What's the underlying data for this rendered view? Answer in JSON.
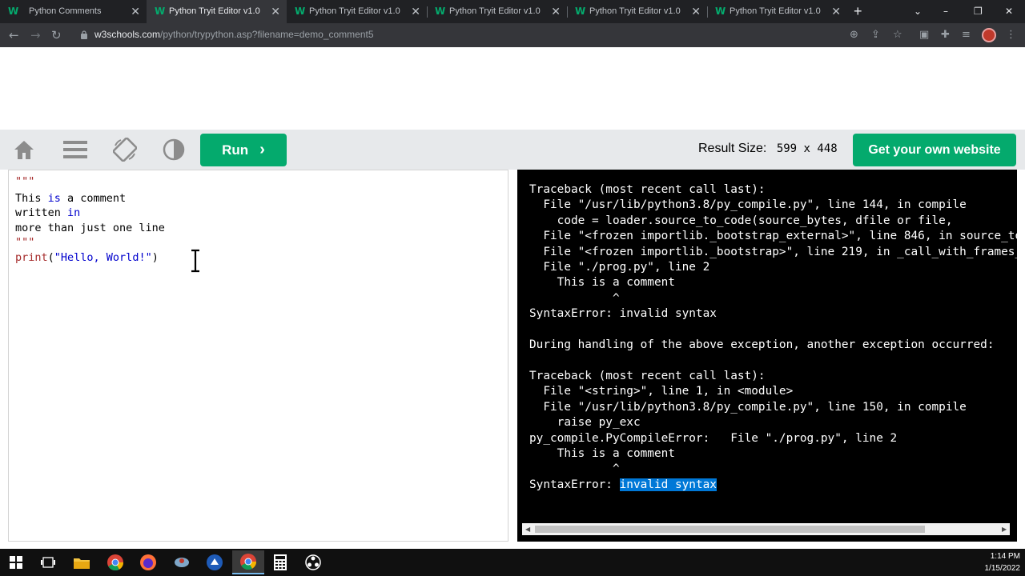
{
  "browser": {
    "tabs": [
      {
        "title": "Python Comments",
        "active": false
      },
      {
        "title": "Python Tryit Editor v1.0",
        "active": true
      },
      {
        "title": "Python Tryit Editor v1.0",
        "active": false
      },
      {
        "title": "Python Tryit Editor v1.0",
        "active": false
      },
      {
        "title": "Python Tryit Editor v1.0",
        "active": false
      },
      {
        "title": "Python Tryit Editor v1.0",
        "active": false
      }
    ],
    "url_host": "w3schools.com",
    "url_path": "/python/trypython.asp?filename=demo_comment5"
  },
  "toolbar": {
    "run_label": "Run",
    "result_size_label": "Result Size:",
    "result_width": "599",
    "result_x": "x",
    "result_height": "448",
    "get_website_label": "Get your own website"
  },
  "editor": {
    "lines": [
      "\"\"\"",
      "This is a comment",
      "written in",
      "more than just one line",
      "\"\"\"",
      "print(\"Hello, World!\")"
    ]
  },
  "output": {
    "lines": [
      "Traceback (most recent call last):",
      "  File \"/usr/lib/python3.8/py_compile.py\", line 144, in compile",
      "    code = loader.source_to_code(source_bytes, dfile or file,",
      "  File \"<frozen importlib._bootstrap_external>\", line 846, in source_to_code",
      "  File \"<frozen importlib._bootstrap>\", line 219, in _call_with_frames_removed",
      "  File \"./prog.py\", line 2",
      "    This is a comment",
      "            ^",
      "SyntaxError: invalid syntax",
      "",
      "During handling of the above exception, another exception occurred:",
      "",
      "Traceback (most recent call last):",
      "  File \"<string>\", line 1, in <module>",
      "  File \"/usr/lib/python3.8/py_compile.py\", line 150, in compile",
      "    raise py_exc",
      "py_compile.PyCompileError:   File \"./prog.py\", line 2",
      "    This is a comment",
      "            ^"
    ],
    "last_prefix": "SyntaxError: ",
    "last_highlight": "invalid syntax"
  },
  "taskbar": {
    "time": "1:14 PM",
    "date": "1/15/2022"
  }
}
